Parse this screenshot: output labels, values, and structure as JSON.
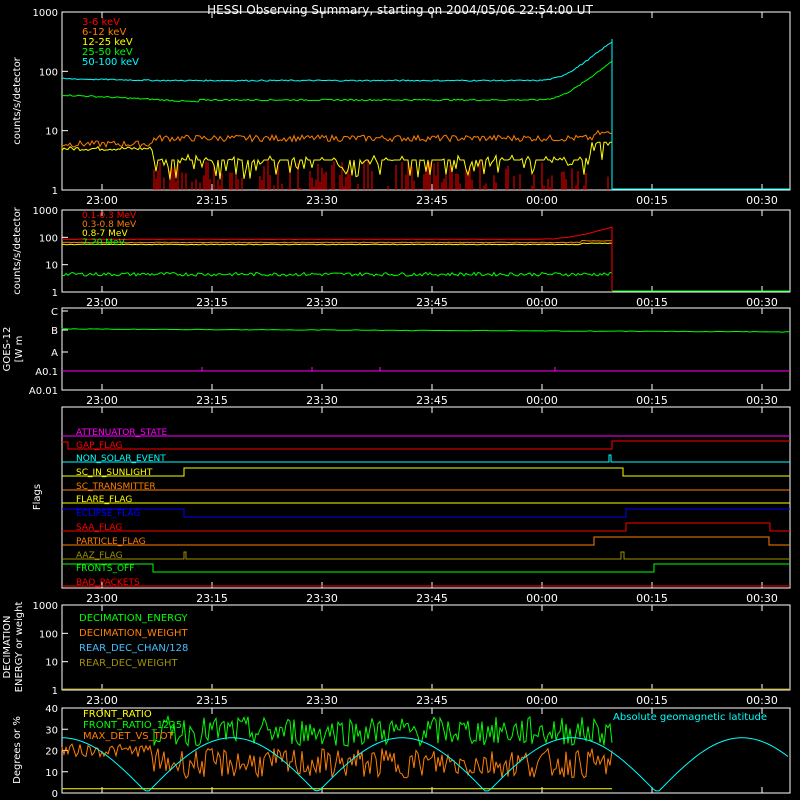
{
  "title": "HESSI Observing Summary, starting on 2004/05/06 22:54:00 UT",
  "time_ticks": [
    "23:00",
    "23:15",
    "23:30",
    "23:45",
    "00:00",
    "00:15",
    "00:30"
  ],
  "colors": {
    "red": "#ff0000",
    "orange": "#ff7f00",
    "yellow": "#ffff00",
    "green": "#00ff00",
    "cyan": "#00ffff",
    "magenta": "#ff00ff",
    "blue": "#0000ff",
    "olive": "#a09000",
    "white": "#ffffff",
    "ltblue": "#40c0ff"
  },
  "chart_data": [
    {
      "id": "low_energy",
      "type": "line",
      "ylabel": "counts/s/detector",
      "yscale": "log",
      "ylim": [
        1,
        1000
      ],
      "ytick_labels": [
        "1",
        "10",
        "100",
        "1000"
      ],
      "series": [
        {
          "name": "3-6 keV",
          "color": "red",
          "level": 1.5
        },
        {
          "name": "6-12 keV",
          "color": "orange",
          "level": 7
        },
        {
          "name": "12-25 keV",
          "color": "yellow",
          "level": 3
        },
        {
          "name": "25-50 keV",
          "color": "green",
          "level": 40
        },
        {
          "name": "50-100 keV",
          "color": "cyan",
          "level": 75
        }
      ]
    },
    {
      "id": "high_energy",
      "type": "line",
      "ylabel": "counts/s/detector",
      "yscale": "log",
      "ylim": [
        1,
        1000
      ],
      "ytick_labels": [
        "1",
        "10",
        "100",
        "1000"
      ],
      "series": [
        {
          "name": "0.1-0.3 MeV",
          "color": "red",
          "level": 90
        },
        {
          "name": "0.3-0.8 MeV",
          "color": "orange",
          "level": 65
        },
        {
          "name": "0.8-7 MeV",
          "color": "yellow",
          "level": 55
        },
        {
          "name": "7-20 MeV",
          "color": "green",
          "level": 4.5
        }
      ]
    },
    {
      "id": "goes",
      "type": "line",
      "ylabel": "GOES-12",
      "ylabel2": "[W m",
      "ytick_labels": [
        "A0.01",
        "A0.1",
        "A",
        "B",
        "C"
      ],
      "series": [
        {
          "name": "long",
          "color": "green",
          "level": "B"
        },
        {
          "name": "short",
          "color": "magenta",
          "level": "A0.1"
        }
      ]
    },
    {
      "id": "flags",
      "type": "line",
      "ylabel": "Flags",
      "series": [
        {
          "name": "ATTENUATOR_STATE",
          "color": "magenta"
        },
        {
          "name": "GAP_FLAG",
          "color": "red"
        },
        {
          "name": "NON_SOLAR_EVENT",
          "color": "cyan"
        },
        {
          "name": "SC_IN_SUNLIGHT",
          "color": "yellow"
        },
        {
          "name": "SC_TRANSMITTER",
          "color": "orange"
        },
        {
          "name": "FLARE_FLAG",
          "color": "yellow"
        },
        {
          "name": "ECLIPSE_FLAG",
          "color": "blue"
        },
        {
          "name": "SAA_FLAG",
          "color": "red"
        },
        {
          "name": "PARTICLE_FLAG",
          "color": "orange"
        },
        {
          "name": "AAZ_FLAG",
          "color": "olive"
        },
        {
          "name": "FRONTS_OFF",
          "color": "green"
        },
        {
          "name": "BAD_PACKETS",
          "color": "red"
        }
      ]
    },
    {
      "id": "decimation",
      "type": "line",
      "ylabel": "DECIMATION",
      "ylabel2": "ENERGY or weight",
      "yscale": "log",
      "ylim": [
        1,
        1000
      ],
      "ytick_labels": [
        "1",
        "10",
        "100",
        "1000"
      ],
      "series": [
        {
          "name": "DECIMATION_ENERGY",
          "color": "green"
        },
        {
          "name": "DECIMATION_WEIGHT",
          "color": "orange"
        },
        {
          "name": "REAR_DEC_CHAN/128",
          "color": "ltblue"
        },
        {
          "name": "REAR_DEC_WEIGHT",
          "color": "olive"
        }
      ]
    },
    {
      "id": "ratios",
      "type": "line",
      "ylabel": "Degrees or %",
      "ylim": [
        0,
        40
      ],
      "ytick_labels": [
        "0",
        "10",
        "20",
        "30",
        "40"
      ],
      "series": [
        {
          "name": "FRONT_RATIO",
          "color": "yellow",
          "level": 2
        },
        {
          "name": "FRONT_RATIO_1225",
          "color": "green",
          "level": 30
        },
        {
          "name": "MAX_DET_VS_TOT",
          "color": "orange",
          "level": 20
        },
        {
          "name": "Absolute geomagnetic latitude",
          "color": "cyan"
        }
      ]
    }
  ]
}
